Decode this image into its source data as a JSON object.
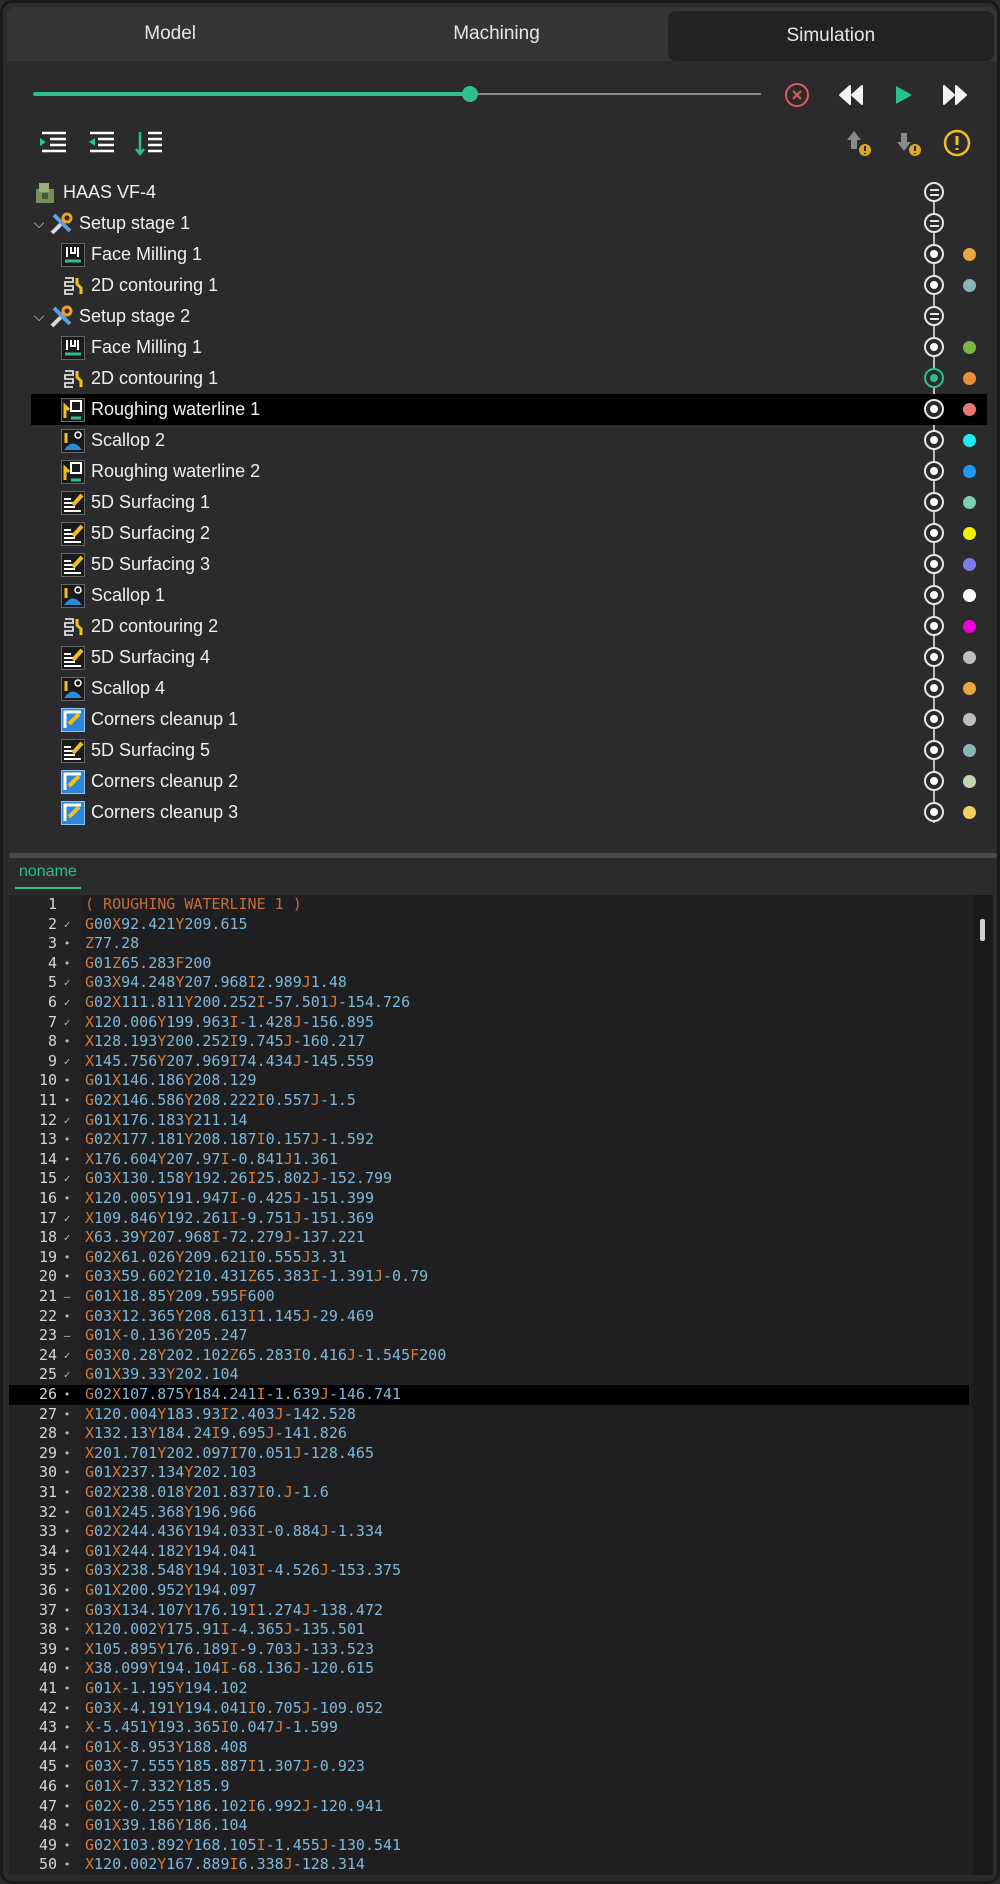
{
  "tabs": [
    {
      "label": "Model",
      "active": false
    },
    {
      "label": "Machining",
      "active": false
    },
    {
      "label": "Simulation",
      "active": true
    }
  ],
  "playback": {
    "progress": 0.6,
    "accent_color": "#2bc08e",
    "icons": [
      "stop-circle-icon",
      "rewind-icon",
      "play-icon",
      "fast-forward-icon"
    ]
  },
  "toolbar": {
    "left_icons": [
      "collapse-list-icon",
      "expand-list-icon",
      "sort-list-icon"
    ],
    "right_icons": [
      "move-up-warning-icon",
      "move-down-warning-icon",
      "warning-icon"
    ]
  },
  "tree": [
    {
      "label": "HAAS VF-4",
      "level": 0,
      "icon": "machine-icon",
      "node": "eq",
      "dot": null
    },
    {
      "label": "Setup stage 1",
      "level": 0,
      "icon": "setup-icon",
      "chevron": true,
      "node": "eq",
      "dot": null
    },
    {
      "label": "Face Milling 1",
      "level": 1,
      "icon": "face-milling-icon",
      "node": "o",
      "dot": "#e8a83a"
    },
    {
      "label": "2D contouring 1",
      "level": 1,
      "icon": "contouring-icon",
      "node": "o",
      "dot": "#8ab4b8"
    },
    {
      "label": "Setup stage 2",
      "level": 0,
      "icon": "setup-icon",
      "chevron": true,
      "node": "eq",
      "dot": null
    },
    {
      "label": "Face Milling 1",
      "level": 1,
      "icon": "face-milling-icon",
      "node": "o",
      "dot": "#7cb342"
    },
    {
      "label": "2D contouring 1",
      "level": 1,
      "icon": "contouring-icon",
      "node": "green",
      "dot": "#e8903a"
    },
    {
      "label": "Roughing waterline 1",
      "level": 1,
      "icon": "roughing-icon",
      "node": "o",
      "dot": "#e87878",
      "selected": true
    },
    {
      "label": "Scallop 2",
      "level": 1,
      "icon": "scallop-icon",
      "node": "o",
      "dot": "#1de9f0"
    },
    {
      "label": "Roughing waterline 2",
      "level": 1,
      "icon": "roughing-icon",
      "node": "o",
      "dot": "#2196f3"
    },
    {
      "label": "5D Surfacing 1",
      "level": 1,
      "icon": "surfacing-icon",
      "node": "o",
      "dot": "#80cbb4"
    },
    {
      "label": "5D Surfacing 2",
      "level": 1,
      "icon": "surfacing-icon",
      "node": "o",
      "dot": "#f5f000"
    },
    {
      "label": "5D Surfacing 3",
      "level": 1,
      "icon": "surfacing-icon",
      "node": "o",
      "dot": "#7b7bef"
    },
    {
      "label": "Scallop 1",
      "level": 1,
      "icon": "scallop-icon",
      "node": "o",
      "dot": "#ffffff"
    },
    {
      "label": "2D contouring 2",
      "level": 1,
      "icon": "contouring-icon",
      "node": "o",
      "dot": "#f000d8"
    },
    {
      "label": "5D Surfacing 4",
      "level": 1,
      "icon": "surfacing-icon",
      "node": "o",
      "dot": "#bdbdbd"
    },
    {
      "label": "Scallop 4",
      "level": 1,
      "icon": "scallop-icon",
      "node": "o",
      "dot": "#e8a83a"
    },
    {
      "label": "Corners cleanup 1",
      "level": 1,
      "icon": "corners-cleanup-icon",
      "node": "o",
      "dot": "#bdbdbd"
    },
    {
      "label": "5D Surfacing 5",
      "level": 1,
      "icon": "surfacing-icon",
      "node": "o",
      "dot": "#8ab4b8"
    },
    {
      "label": "Corners cleanup 2",
      "level": 1,
      "icon": "corners-cleanup-icon",
      "node": "o",
      "dot": "#c5d4b0"
    },
    {
      "label": "Corners cleanup 3",
      "level": 1,
      "icon": "corners-cleanup-icon",
      "node": "o",
      "dot": "#f5d060"
    }
  ],
  "editor": {
    "file_tab": "noname",
    "highlighted_line": 26,
    "lines": [
      {
        "n": "1",
        "m": "",
        "t": "( ROUGHING WATERLINE 1 )"
      },
      {
        "n": "2",
        "m": "✓",
        "t": "G00X92.421Y209.615"
      },
      {
        "n": "3",
        "m": "•",
        "t": "Z77.28"
      },
      {
        "n": "4",
        "m": "•",
        "t": "G01Z65.283F200"
      },
      {
        "n": "5",
        "m": "✓",
        "t": "G03X94.248Y207.968I2.989J1.48"
      },
      {
        "n": "6",
        "m": "✓",
        "t": "G02X111.811Y200.252I-57.501J-154.726"
      },
      {
        "n": "7",
        "m": "✓",
        "t": "X120.006Y199.963I-1.428J-156.895"
      },
      {
        "n": "8",
        "m": "•",
        "t": "X128.193Y200.252I9.745J-160.217"
      },
      {
        "n": "9",
        "m": "✓",
        "t": "X145.756Y207.969I74.434J-145.559"
      },
      {
        "n": "10",
        "m": "•",
        "t": "G01X146.186Y208.129"
      },
      {
        "n": "11",
        "m": "•",
        "t": "G02X146.586Y208.222I0.557J-1.5"
      },
      {
        "n": "12",
        "m": "✓",
        "t": "G01X176.183Y211.14"
      },
      {
        "n": "13",
        "m": "•",
        "t": "G02X177.181Y208.187I0.157J-1.592"
      },
      {
        "n": "14",
        "m": "•",
        "t": "X176.604Y207.97I-0.841J1.361"
      },
      {
        "n": "15",
        "m": "✓",
        "t": "G03X130.158Y192.26I25.802J-152.799"
      },
      {
        "n": "16",
        "m": "•",
        "t": "X120.005Y191.947I-0.425J-151.399"
      },
      {
        "n": "17",
        "m": "✓",
        "t": "X109.846Y192.261I-9.751J-151.369"
      },
      {
        "n": "18",
        "m": "✓",
        "t": "X63.39Y207.968I-72.279J-137.221"
      },
      {
        "n": "19",
        "m": "•",
        "t": "G02X61.026Y209.621I0.555J3.31"
      },
      {
        "n": "20",
        "m": "•",
        "t": "G03X59.602Y210.431Z65.383I-1.391J-0.79"
      },
      {
        "n": "21",
        "m": "—",
        "t": "G01X18.85Y209.595F600"
      },
      {
        "n": "22",
        "m": "•",
        "t": "G03X12.365Y208.613I1.145J-29.469"
      },
      {
        "n": "23",
        "m": "—",
        "t": "G01X-0.136Y205.247"
      },
      {
        "n": "24",
        "m": "✓",
        "t": "G03X0.28Y202.102Z65.283I0.416J-1.545F200"
      },
      {
        "n": "25",
        "m": "✓",
        "t": "G01X39.33Y202.104"
      },
      {
        "n": "26",
        "m": "•",
        "t": "G02X107.875Y184.241I-1.639J-146.741"
      },
      {
        "n": "27",
        "m": "•",
        "t": "X120.004Y183.93I2.403J-142.528"
      },
      {
        "n": "28",
        "m": "•",
        "t": "X132.13Y184.24I9.695J-141.826"
      },
      {
        "n": "29",
        "m": "•",
        "t": "X201.701Y202.097I70.051J-128.465"
      },
      {
        "n": "30",
        "m": "•",
        "t": "G01X237.134Y202.103"
      },
      {
        "n": "31",
        "m": "•",
        "t": "G02X238.018Y201.837I0.J-1.6"
      },
      {
        "n": "32",
        "m": "•",
        "t": "G01X245.368Y196.966"
      },
      {
        "n": "33",
        "m": "•",
        "t": "G02X244.436Y194.033I-0.884J-1.334"
      },
      {
        "n": "34",
        "m": "•",
        "t": "G01X244.182Y194.041"
      },
      {
        "n": "35",
        "m": "•",
        "t": "G03X238.548Y194.103I-4.526J-153.375"
      },
      {
        "n": "36",
        "m": "•",
        "t": "G01X200.952Y194.097"
      },
      {
        "n": "37",
        "m": "•",
        "t": "G03X134.107Y176.19I1.274J-138.472"
      },
      {
        "n": "38",
        "m": "•",
        "t": "X120.002Y175.91I-4.365J-135.501"
      },
      {
        "n": "39",
        "m": "•",
        "t": "X105.895Y176.189I-9.703J-133.523"
      },
      {
        "n": "40",
        "m": "•",
        "t": "X38.099Y194.104I-68.136J-120.615"
      },
      {
        "n": "41",
        "m": "•",
        "t": "G01X-1.195Y194.102"
      },
      {
        "n": "42",
        "m": "•",
        "t": "G03X-4.191Y194.041I0.705J-109.052"
      },
      {
        "n": "43",
        "m": "•",
        "t": "X-5.451Y193.365I0.047J-1.599"
      },
      {
        "n": "44",
        "m": "•",
        "t": "G01X-8.953Y188.408"
      },
      {
        "n": "45",
        "m": "•",
        "t": "G03X-7.555Y185.887I1.307J-0.923"
      },
      {
        "n": "46",
        "m": "•",
        "t": "G01X-7.332Y185.9"
      },
      {
        "n": "47",
        "m": "•",
        "t": "G02X-0.255Y186.102I6.992J-120.941"
      },
      {
        "n": "48",
        "m": "•",
        "t": "G01X39.186Y186.104"
      },
      {
        "n": "49",
        "m": "•",
        "t": "G02X103.892Y168.105I-1.455J-130.541"
      },
      {
        "n": "50",
        "m": "•",
        "t": "X120.002Y167.889I6.338J-128.314"
      }
    ]
  }
}
